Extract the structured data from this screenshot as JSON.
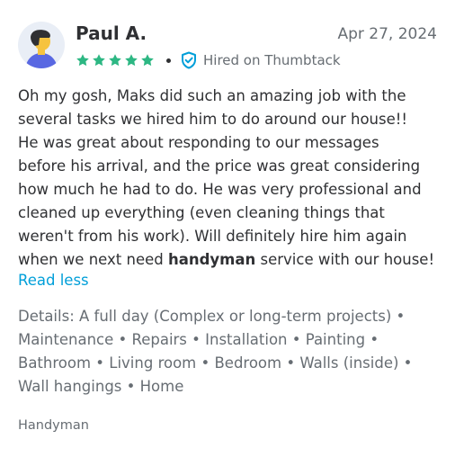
{
  "review": {
    "author": "Paul A.",
    "date": "Apr 27, 2024",
    "rating": 5,
    "rating_max": 5,
    "separator": "•",
    "hired_label": "Hired on Thumbtack",
    "body_lines": [
      "Oh my gosh, Maks did such an amazing job with the",
      "several tasks we hired him to do around our house!!",
      "He was great about responding to our messages",
      "before his arrival, and the price was great considering",
      "how much he had to do. He was very professional and",
      "cleaned up everything (even cleaning things that",
      "weren't from his work). Will definitely hire him again"
    ],
    "body_last_prefix": "when we next need ",
    "body_last_bold": "handyman",
    "body_last_suffix": " service with our house!",
    "read_less_label": "Read less",
    "details_lines": [
      "Details: A full day (Complex or long-term projects) •",
      "Maintenance • Repairs • Installation • Painting •",
      "Bathroom • Living room • Bedroom • Walls (inside) •",
      "Wall hangings • Home"
    ],
    "category": "Handyman"
  },
  "colors": {
    "star": "#2db783",
    "shield": "#009fd9",
    "link": "#009fd9",
    "text": "#2f3033",
    "muted": "#676d73",
    "avatar_bg": "#e9eef6",
    "avatar_shirt": "#5968e2",
    "avatar_hair": "#2f3033",
    "avatar_skin": "#f6c33f"
  },
  "icons": {
    "avatar": "person-avatar-icon",
    "star": "star-icon",
    "shield": "shield-check-icon"
  }
}
